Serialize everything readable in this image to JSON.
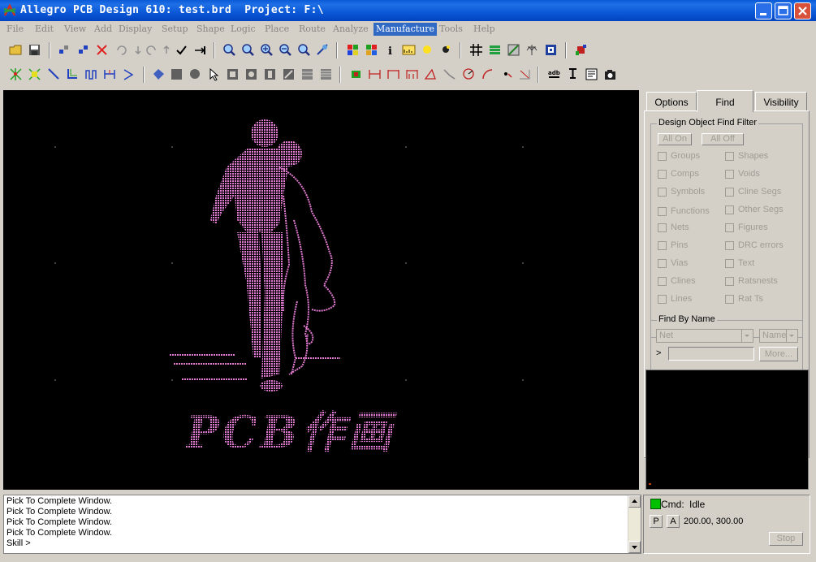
{
  "window": {
    "title": "Allegro PCB Design 610: test.brd  Project: F:\\"
  },
  "menu": [
    {
      "label": "File",
      "state": "disabled"
    },
    {
      "label": "Edit",
      "state": "disabled"
    },
    {
      "label": "View",
      "state": "disabled"
    },
    {
      "label": "Add",
      "state": "disabled"
    },
    {
      "label": "Display",
      "state": "disabled"
    },
    {
      "label": "Setup",
      "state": "disabled"
    },
    {
      "label": "Shape",
      "state": "disabled"
    },
    {
      "label": "Logic",
      "state": "disabled"
    },
    {
      "label": "Place",
      "state": "disabled"
    },
    {
      "label": "Route",
      "state": "disabled"
    },
    {
      "label": "Analyze",
      "state": "disabled"
    },
    {
      "label": "Manufacture",
      "state": "active"
    },
    {
      "label": "Tools",
      "state": "disabled"
    },
    {
      "label": "Help",
      "state": "disabled"
    }
  ],
  "canvas": {
    "art_text": "PCB作画",
    "art_color": "#e07ad0",
    "background": "#000000"
  },
  "panel": {
    "tabs": [
      "Options",
      "Find",
      "Visibility"
    ],
    "active_tab": "Find",
    "find_filter": {
      "title": "Design Object Find Filter",
      "all_on": "All On",
      "all_off": "All Off",
      "left_items": [
        "Groups",
        "Comps",
        "Symbols",
        "Functions",
        "Nets",
        "Pins",
        "Vias",
        "Clines",
        "Lines"
      ],
      "right_items": [
        "Shapes",
        "Voids",
        "Cline Segs",
        "Other Segs",
        "Figures",
        "DRC errors",
        "Text",
        "Ratsnests",
        "Rat Ts"
      ]
    },
    "find_by_name": {
      "title": "Find By Name",
      "type_value": "Net",
      "mode_value": "Name",
      "prompt": ">",
      "more_button": "More..."
    }
  },
  "console": {
    "lines": [
      "Pick To Complete Window.",
      "Pick To Complete Window.",
      "Pick To Complete Window.",
      "Pick To Complete Window.",
      "Skill >"
    ]
  },
  "status": {
    "cmd_label": "Cmd:",
    "cmd_value": "Idle",
    "cmd_color": "#00c000",
    "p_button": "P",
    "a_button": "A",
    "coordinates": "200.00, 300.00",
    "stop_button": "Stop"
  }
}
